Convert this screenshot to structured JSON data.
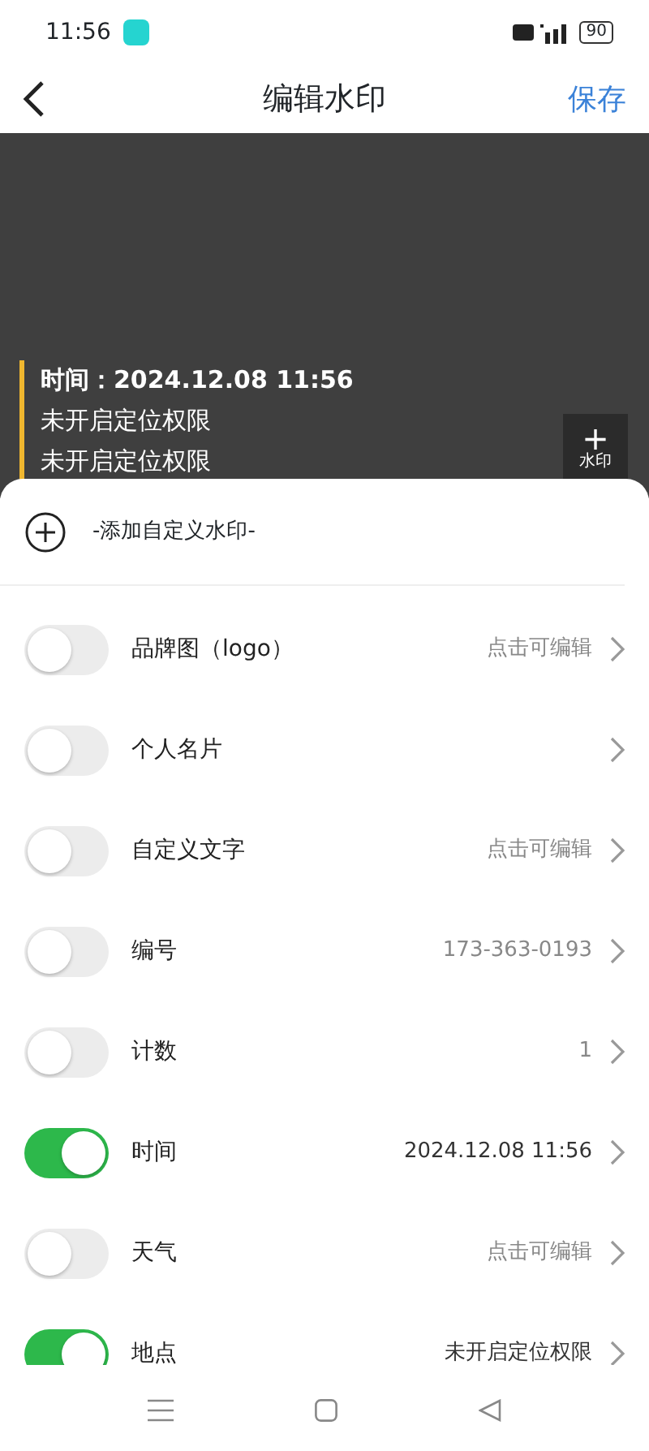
{
  "status_bar": {
    "time": "11:56",
    "battery": "90"
  },
  "header": {
    "title": "编辑水印",
    "save": "保存"
  },
  "preview": {
    "lines": [
      {
        "text": "时间：2024.12.08 11:56",
        "bold": true
      },
      {
        "text": "未开启定位权限",
        "bold": false
      },
      {
        "text": "未开启定位权限",
        "bold": false
      }
    ],
    "add_button": {
      "symbol": "+",
      "label": "水印"
    }
  },
  "add_custom": {
    "label": "-添加自定义水印-"
  },
  "items": [
    {
      "label": "品牌图（logo）",
      "value": "点击可编辑",
      "on": false
    },
    {
      "label": "个人名片",
      "on": false
    },
    {
      "label": "自定义文字",
      "value": "点击可编辑",
      "on": false
    },
    {
      "label": "编号",
      "value": "173-363-0193",
      "on": false
    },
    {
      "label": "计数",
      "value": "1",
      "on": false
    },
    {
      "label": "时间",
      "value": "2024.12.08 11:56",
      "on": true
    },
    {
      "label": "天气",
      "value": "点击可编辑",
      "on": false
    },
    {
      "label": "地点",
      "value": "未开启定位权限",
      "on": true
    }
  ]
}
